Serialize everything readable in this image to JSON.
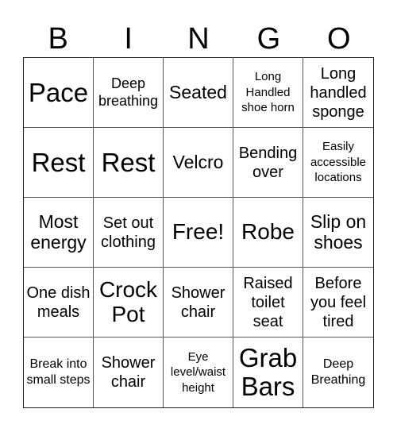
{
  "header": [
    "B",
    "I",
    "N",
    "G",
    "O"
  ],
  "cells": [
    {
      "text": "Pace",
      "size": "s-xl"
    },
    {
      "text": "Deep breathing",
      "size": "s-s"
    },
    {
      "text": "Seated",
      "size": "s-m"
    },
    {
      "text": "Long Handled shoe horn",
      "size": "s-xxs"
    },
    {
      "text": "Long handled sponge",
      "size": "s-ms"
    },
    {
      "text": "Rest",
      "size": "s-xl"
    },
    {
      "text": "Rest",
      "size": "s-xl"
    },
    {
      "text": "Velcro",
      "size": "s-m"
    },
    {
      "text": "Bending over",
      "size": "s-ms"
    },
    {
      "text": "Easily accessible locations",
      "size": "s-xxs"
    },
    {
      "text": "Most energy",
      "size": "s-m"
    },
    {
      "text": "Set out clothing",
      "size": "s-ms"
    },
    {
      "text": "Free!",
      "size": "s-l"
    },
    {
      "text": "Robe",
      "size": "s-l"
    },
    {
      "text": "Slip on shoes",
      "size": "s-m"
    },
    {
      "text": "One dish meals",
      "size": "s-ms"
    },
    {
      "text": "Crock Pot",
      "size": "s-l"
    },
    {
      "text": "Shower chair",
      "size": "s-ms"
    },
    {
      "text": "Raised toilet seat",
      "size": "s-ms"
    },
    {
      "text": "Before you feel tired",
      "size": "s-ms"
    },
    {
      "text": "Break into small steps",
      "size": "s-xs"
    },
    {
      "text": "Shower chair",
      "size": "s-ms"
    },
    {
      "text": "Eye level/waist height",
      "size": "s-xxs"
    },
    {
      "text": "Grab Bars",
      "size": "s-xl"
    },
    {
      "text": "Deep Breathing",
      "size": "s-xs"
    }
  ]
}
